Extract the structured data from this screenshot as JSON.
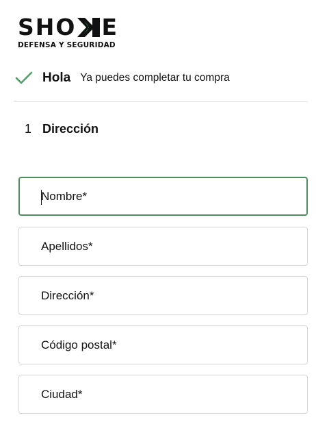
{
  "brand": {
    "name": "SHOKE",
    "name_prefix": "SHO",
    "tagline": "DEFENSA Y SEGURIDAD",
    "accent_color": "#1f7a3a"
  },
  "greeting": {
    "icon": "check-icon",
    "icon_color": "#4e9e67",
    "title": "Hola",
    "message": "Ya puedes completar tu compra"
  },
  "step": {
    "number": "1",
    "title": "Dirección"
  },
  "form": {
    "focus_color": "#4e8e5c",
    "fields": [
      {
        "placeholder": "Nombre*",
        "value": ""
      },
      {
        "placeholder": "Apellidos*",
        "value": ""
      },
      {
        "placeholder": "Dirección*",
        "value": ""
      },
      {
        "placeholder": "Código postal*",
        "value": ""
      },
      {
        "placeholder": "Ciudad*",
        "value": ""
      }
    ]
  }
}
